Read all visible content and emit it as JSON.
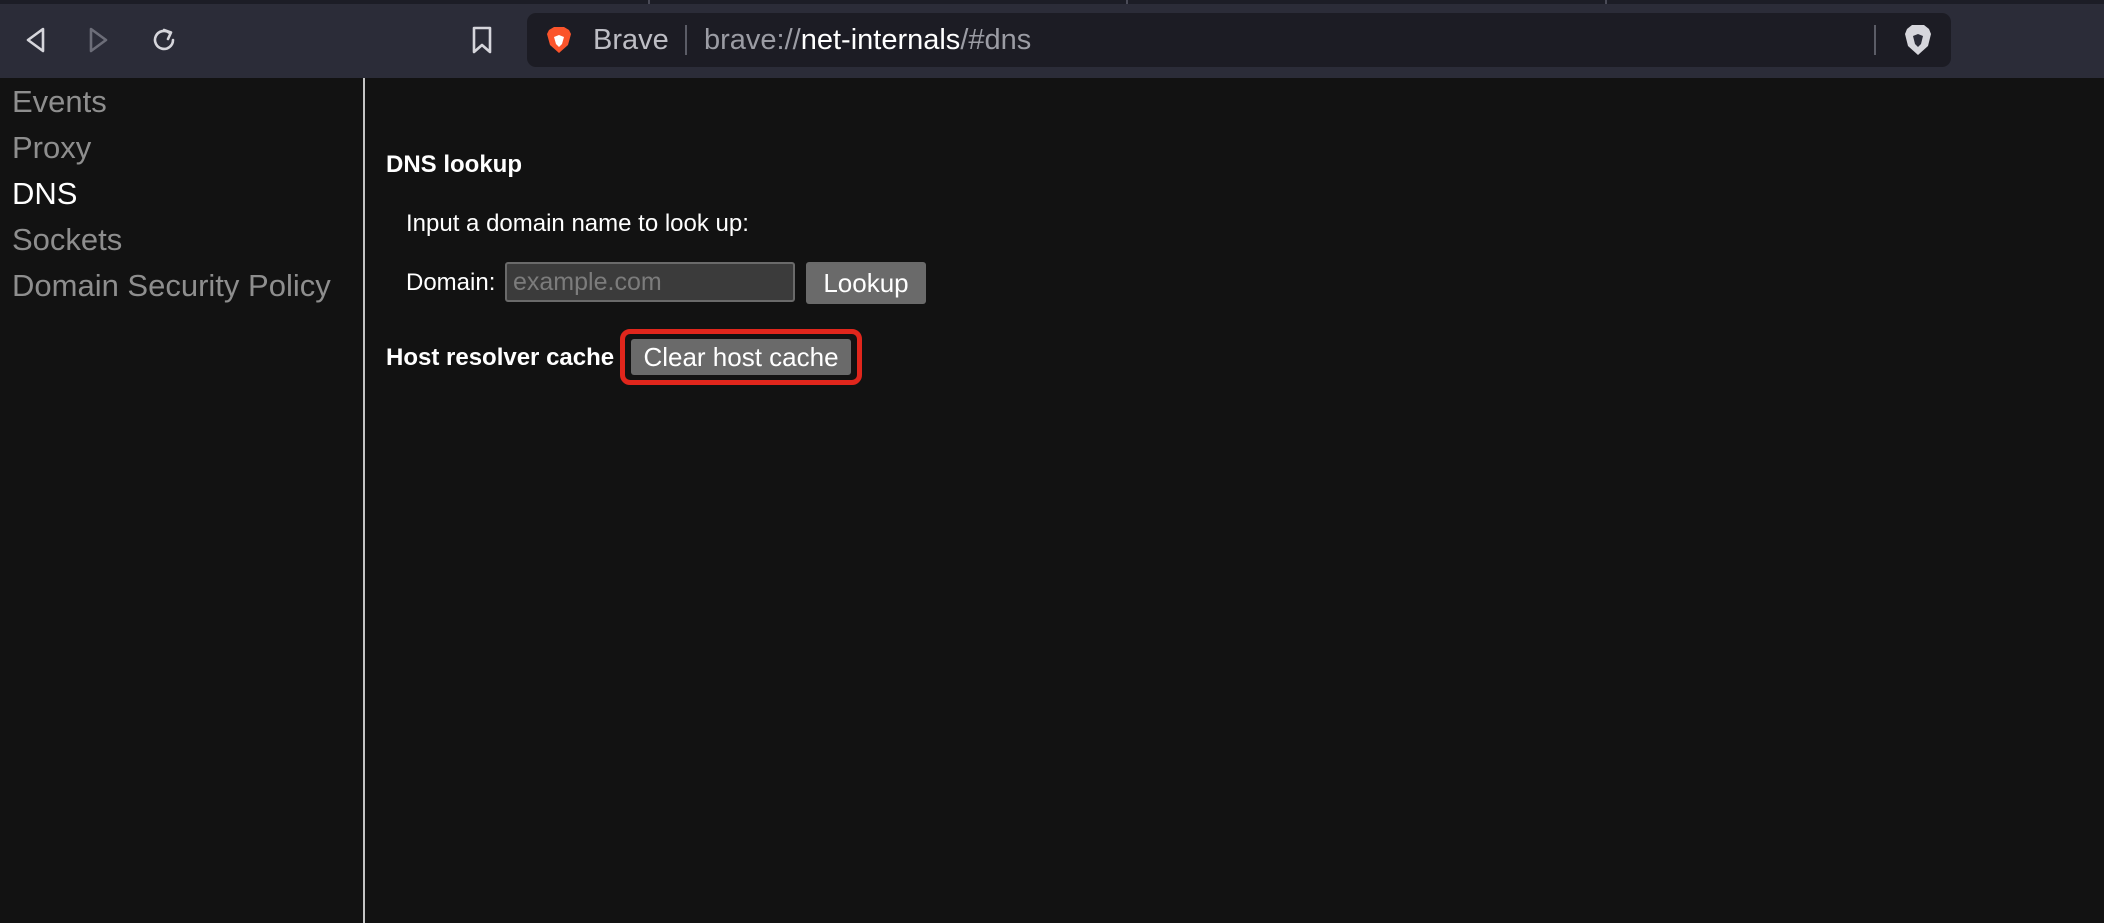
{
  "browser": {
    "brand_label": "Brave",
    "url_scheme": "brave://",
    "url_host": "net-internals",
    "url_rest": "/#dns",
    "icons": {
      "back": "back-arrow-icon",
      "forward": "forward-arrow-icon",
      "reload": "reload-icon",
      "bookmark": "bookmark-icon",
      "brand": "brave-lion-icon",
      "shields": "brave-shields-icon"
    }
  },
  "sidebar": {
    "items": [
      {
        "label": "Events",
        "active": false
      },
      {
        "label": "Proxy",
        "active": false
      },
      {
        "label": "DNS",
        "active": true
      },
      {
        "label": "Sockets",
        "active": false
      },
      {
        "label": "Domain Security Policy",
        "active": false
      }
    ]
  },
  "dns": {
    "lookup_heading": "DNS lookup",
    "prompt": "Input a domain name to look up:",
    "domain_label": "Domain:",
    "domain_placeholder": "example.com",
    "domain_value": "",
    "lookup_button": "Lookup",
    "host_cache_heading": "Host resolver cache",
    "clear_cache_button": "Clear host cache"
  },
  "colors": {
    "background": "#121212",
    "toolbar": "#2b2c38",
    "highlight": "#e0261c",
    "button": "#6a6a6a",
    "brand": "#fb542b"
  }
}
